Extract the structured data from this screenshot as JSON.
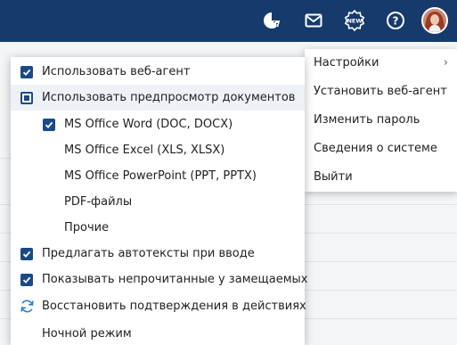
{
  "header": {
    "icons": [
      "dashboard-icon",
      "mail-icon",
      "new-badge-icon",
      "help-icon"
    ],
    "new_badge_text": "NEW",
    "help_glyph": "?",
    "bg_color": "#163a6b"
  },
  "user_menu": {
    "items": [
      {
        "label": "Настройки",
        "has_submenu": true
      },
      {
        "label": "Установить веб-агент"
      },
      {
        "label": "Изменить пароль"
      },
      {
        "label": "Сведения о системе"
      },
      {
        "label": "Выйти"
      }
    ]
  },
  "settings_menu": {
    "items": [
      {
        "label": "Использовать веб-агент",
        "state": "checked"
      },
      {
        "label": "Использовать предпросмотр документов",
        "state": "partial",
        "highlighted": true
      },
      {
        "label": "MS Office Word (DOC, DOCX)",
        "state": "checked"
      },
      {
        "label": "MS Office Excel (XLS, XLSX)",
        "state": "unchecked"
      },
      {
        "label": "MS Office PowerPoint (PPT, PPTX)",
        "state": "unchecked"
      },
      {
        "label": "PDF-файлы",
        "state": "unchecked"
      },
      {
        "label": "Прочие",
        "state": "unchecked"
      },
      {
        "label": "Предлагать автотексты при вводе",
        "state": "checked"
      },
      {
        "label": "Показывать непрочитанные у замещаемых",
        "state": "checked"
      },
      {
        "label": "Восстановить подтверждения в действиях",
        "icon": "refresh-icon"
      },
      {
        "label": "Ночной режим"
      }
    ]
  },
  "colors": {
    "accent": "#1a4a86",
    "refresh_icon": "#2f7fd0"
  }
}
